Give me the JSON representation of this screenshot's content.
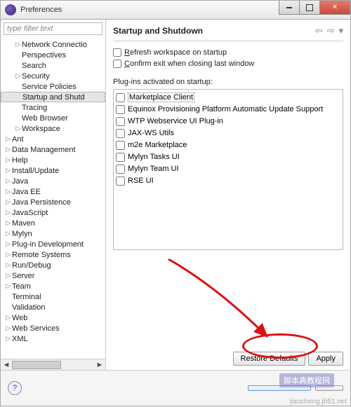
{
  "window": {
    "title": "Preferences"
  },
  "sidebar": {
    "filter_placeholder": "type filter text",
    "items": [
      {
        "label": "Network Connectio",
        "expandable": true,
        "depth": 1
      },
      {
        "label": "Perspectives",
        "expandable": false,
        "depth": 1
      },
      {
        "label": "Search",
        "expandable": false,
        "depth": 1
      },
      {
        "label": "Security",
        "expandable": true,
        "depth": 1
      },
      {
        "label": "Service Policies",
        "expandable": false,
        "depth": 1
      },
      {
        "label": "Startup and Shutd",
        "expandable": false,
        "depth": 1,
        "selected": true
      },
      {
        "label": "Tracing",
        "expandable": false,
        "depth": 1
      },
      {
        "label": "Web Browser",
        "expandable": false,
        "depth": 1
      },
      {
        "label": "Workspace",
        "expandable": true,
        "depth": 1
      },
      {
        "label": "Ant",
        "expandable": true,
        "depth": 0
      },
      {
        "label": "Data Management",
        "expandable": true,
        "depth": 0
      },
      {
        "label": "Help",
        "expandable": true,
        "depth": 0
      },
      {
        "label": "Install/Update",
        "expandable": true,
        "depth": 0
      },
      {
        "label": "Java",
        "expandable": true,
        "depth": 0
      },
      {
        "label": "Java EE",
        "expandable": true,
        "depth": 0
      },
      {
        "label": "Java Persistence",
        "expandable": true,
        "depth": 0
      },
      {
        "label": "JavaScript",
        "expandable": true,
        "depth": 0
      },
      {
        "label": "Maven",
        "expandable": true,
        "depth": 0
      },
      {
        "label": "Mylyn",
        "expandable": true,
        "depth": 0
      },
      {
        "label": "Plug-in Development",
        "expandable": true,
        "depth": 0
      },
      {
        "label": "Remote Systems",
        "expandable": true,
        "depth": 0
      },
      {
        "label": "Run/Debug",
        "expandable": true,
        "depth": 0
      },
      {
        "label": "Server",
        "expandable": true,
        "depth": 0
      },
      {
        "label": "Team",
        "expandable": true,
        "depth": 0
      },
      {
        "label": "Terminal",
        "expandable": false,
        "depth": 0
      },
      {
        "label": "Validation",
        "expandable": false,
        "depth": 0
      },
      {
        "label": "Web",
        "expandable": true,
        "depth": 0
      },
      {
        "label": "Web Services",
        "expandable": true,
        "depth": 0
      },
      {
        "label": "XML",
        "expandable": true,
        "depth": 0
      }
    ]
  },
  "main": {
    "heading": "Startup and Shutdown",
    "refresh_label": "Refresh workspace on startup",
    "confirm_label": "Confirm exit when closing last window",
    "plugins_label": "Plug-ins activated on startup:",
    "plugins": [
      {
        "label": "Marketplace Client",
        "selected": true
      },
      {
        "label": "Equinox Provisioning Platform Automatic Update Support"
      },
      {
        "label": "WTP Webservice UI Plug-in"
      },
      {
        "label": "JAX-WS Utils"
      },
      {
        "label": "m2e Marketplace"
      },
      {
        "label": "Mylyn Tasks UI"
      },
      {
        "label": "Mylyn Team UI"
      },
      {
        "label": "RSE UI"
      }
    ],
    "restore_label": "Restore Defaults",
    "apply_label": "Apply"
  },
  "footer": {
    "ok_label": "",
    "cancel_label": ""
  },
  "watermark": {
    "small": "jiaocheng.jb51.net",
    "box": "脚本典教程网"
  }
}
